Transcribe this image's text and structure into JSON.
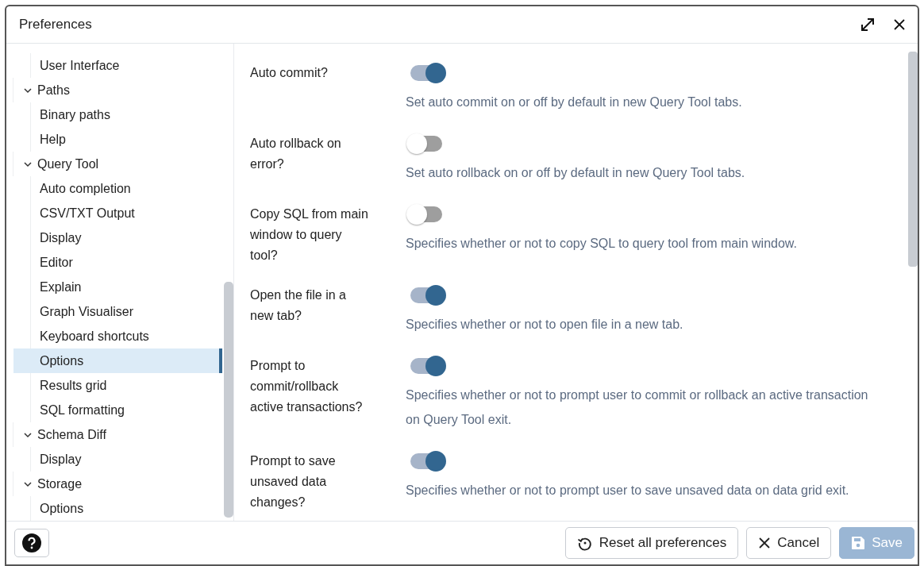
{
  "dialog": {
    "title": "Preferences"
  },
  "tree": [
    {
      "children": [
        {
          "label": "User Interface",
          "selected": false
        }
      ]
    },
    {
      "label": "Paths",
      "expanded": true,
      "children": [
        {
          "label": "Binary paths",
          "selected": false
        },
        {
          "label": "Help",
          "selected": false
        }
      ]
    },
    {
      "label": "Query Tool",
      "expanded": true,
      "children": [
        {
          "label": "Auto completion",
          "selected": false
        },
        {
          "label": "CSV/TXT Output",
          "selected": false
        },
        {
          "label": "Display",
          "selected": false
        },
        {
          "label": "Editor",
          "selected": false
        },
        {
          "label": "Explain",
          "selected": false
        },
        {
          "label": "Graph Visualiser",
          "selected": false
        },
        {
          "label": "Keyboard shortcuts",
          "selected": false
        },
        {
          "label": "Options",
          "selected": true
        },
        {
          "label": "Results grid",
          "selected": false
        },
        {
          "label": "SQL formatting",
          "selected": false
        }
      ]
    },
    {
      "label": "Schema Diff",
      "expanded": true,
      "children": [
        {
          "label": "Display",
          "selected": false
        }
      ]
    },
    {
      "label": "Storage",
      "expanded": true,
      "children": [
        {
          "label": "Options",
          "selected": false
        }
      ]
    }
  ],
  "settings": [
    {
      "label": "Auto commit?",
      "on": true,
      "description": "Set auto commit on or off by default in new Query Tool tabs."
    },
    {
      "label": "Auto rollback on error?",
      "on": false,
      "description": "Set auto rollback on or off by default in new Query Tool tabs."
    },
    {
      "label": "Copy SQL from main window to query tool?",
      "on": false,
      "description": "Specifies whether or not to copy SQL to query tool from main window."
    },
    {
      "label": "Open the file in a new tab?",
      "on": true,
      "description": "Specifies whether or not to open file in a new tab."
    },
    {
      "label": "Prompt to commit/rollback active transactions?",
      "on": true,
      "description": "Specifies whether or not to prompt user to commit or rollback an active transaction on Query Tool exit."
    },
    {
      "label": "Prompt to save unsaved data changes?",
      "on": true,
      "description": "Specifies whether or not to prompt user to save unsaved data on data grid exit."
    }
  ],
  "footer": {
    "buttons": [
      {
        "kind": "reset",
        "label": "Reset all preferences",
        "disabled": false
      },
      {
        "kind": "cancel",
        "label": "Cancel",
        "disabled": false
      },
      {
        "kind": "save",
        "label": "Save",
        "disabled": true
      }
    ]
  }
}
